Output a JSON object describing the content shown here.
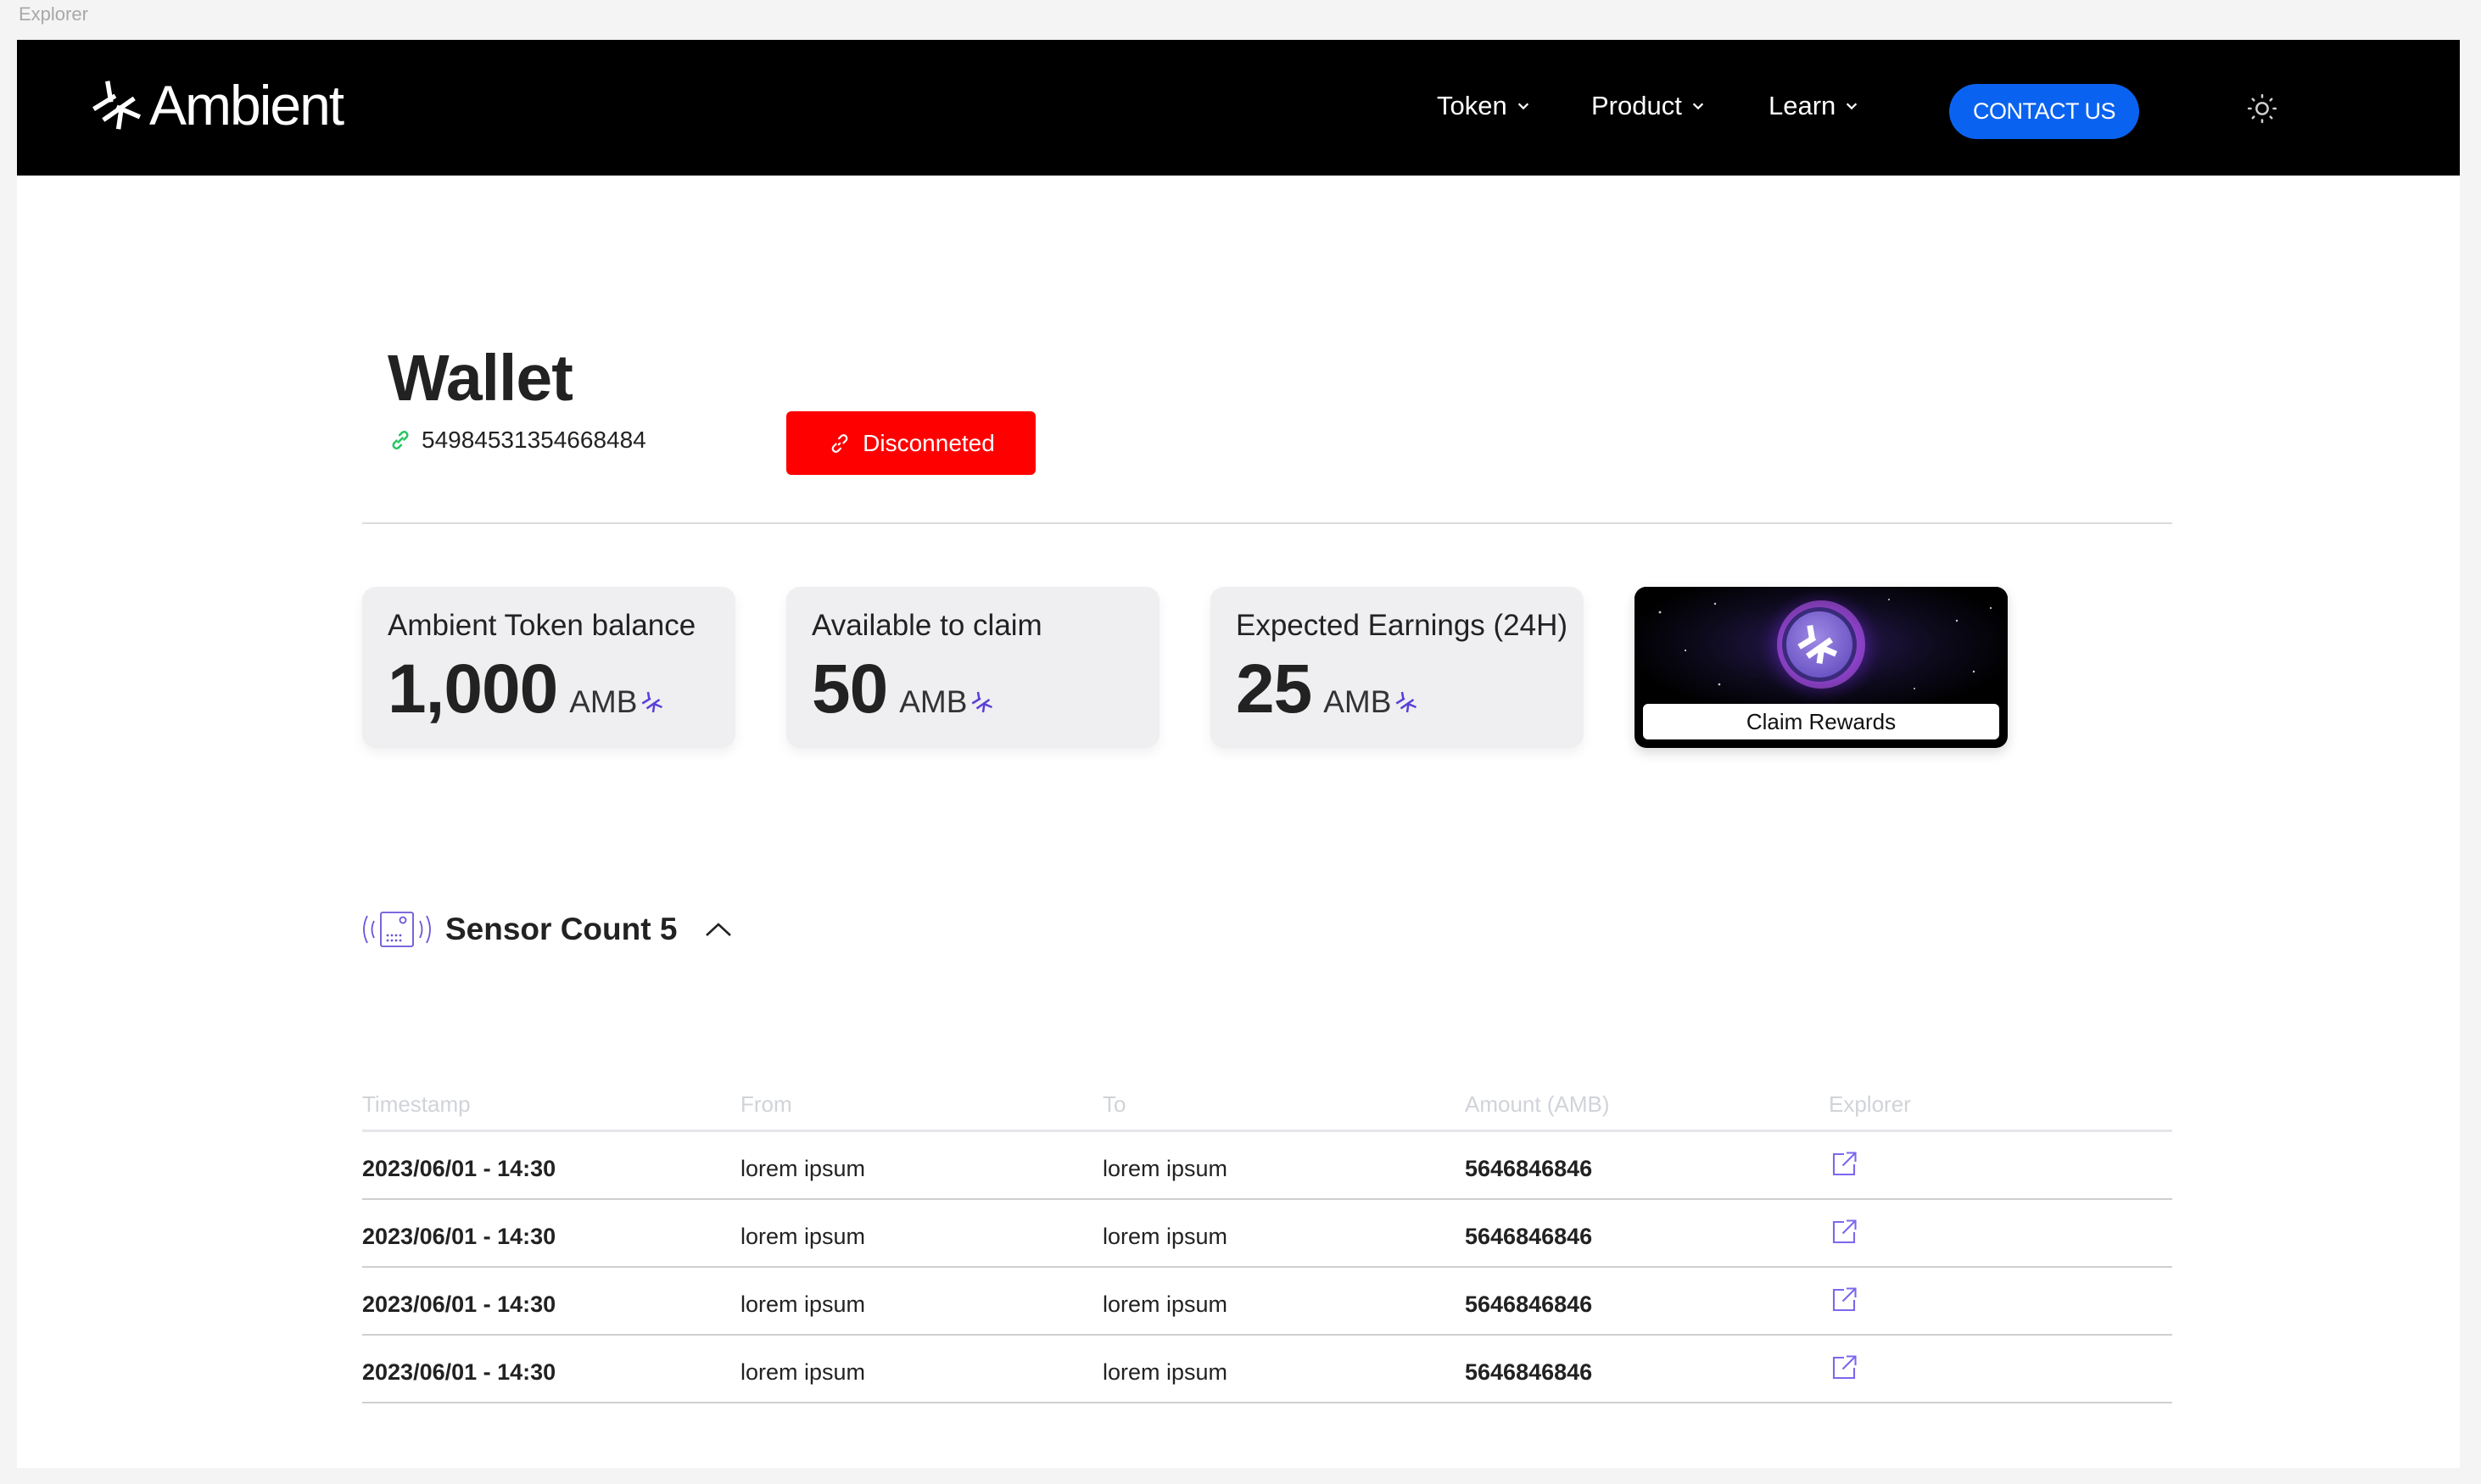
{
  "window": {
    "title": "Explorer"
  },
  "header": {
    "logo_text": "Ambient",
    "nav": [
      {
        "label": "Token"
      },
      {
        "label": "Product"
      },
      {
        "label": "Learn"
      }
    ],
    "contact_label": "CONTACT US",
    "theme_icon": "sun-icon"
  },
  "wallet": {
    "title": "Wallet",
    "address": "54984531354668484",
    "status_label": "Disconneted",
    "colors": {
      "status_bg": "#ff0000",
      "link_icon": "#22c55e",
      "accent": "#0a63f0",
      "brand_purple": "#5b3fd8"
    }
  },
  "cards": [
    {
      "label": "Ambient Token balance",
      "value": "1,000",
      "unit": "AMB"
    },
    {
      "label": "Available to claim",
      "value": "50",
      "unit": "AMB"
    },
    {
      "label": "Expected Earnings (24H)",
      "value": "25",
      "unit": "AMB"
    }
  ],
  "claim": {
    "label": "Claim Rewards"
  },
  "sensors": {
    "title": "Sensor Count 5",
    "expanded": true
  },
  "table": {
    "columns": [
      "Timestamp",
      "From",
      "To",
      "Amount (AMB)",
      "Explorer"
    ],
    "rows": [
      {
        "timestamp": "2023/06/01 - 14:30",
        "from": "lorem ipsum",
        "to": "lorem ipsum",
        "amount": "5646846846"
      },
      {
        "timestamp": "2023/06/01 - 14:30",
        "from": "lorem ipsum",
        "to": "lorem ipsum",
        "amount": "5646846846"
      },
      {
        "timestamp": "2023/06/01 - 14:30",
        "from": "lorem ipsum",
        "to": "lorem ipsum",
        "amount": "5646846846"
      },
      {
        "timestamp": "2023/06/01 - 14:30",
        "from": "lorem ipsum",
        "to": "lorem ipsum",
        "amount": "5646846846"
      }
    ]
  }
}
